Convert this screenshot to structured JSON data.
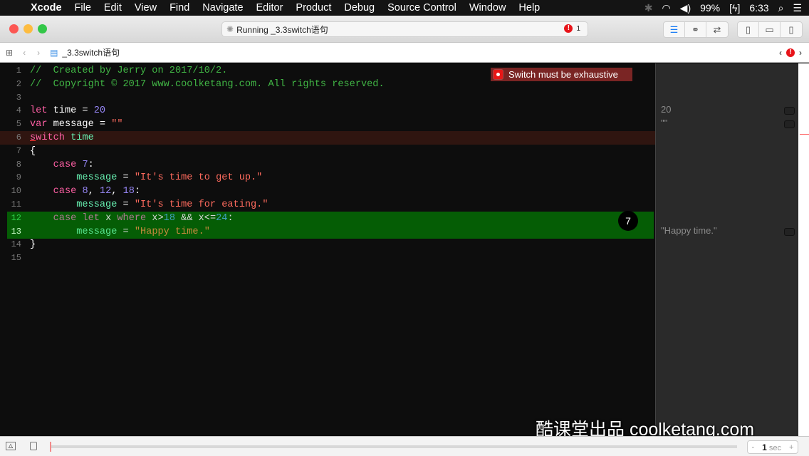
{
  "menubar": {
    "app": "Xcode",
    "items": [
      "File",
      "Edit",
      "View",
      "Find",
      "Navigate",
      "Editor",
      "Product",
      "Debug",
      "Source Control",
      "Window",
      "Help"
    ],
    "battery": "99%",
    "time": "6:33"
  },
  "toolbar": {
    "activity": "Running _3.3switch语句",
    "error_count": "1"
  },
  "jumpbar": {
    "file": "_3.3switch语句"
  },
  "editor": {
    "lines": [
      [
        [
          "//  Created by Jerry on 2017/10/2.",
          "comment"
        ]
      ],
      [
        [
          "//  Copyright © 2017 www.coolketang.com. All rights reserved.",
          "comment"
        ]
      ],
      [],
      [
        [
          "let",
          "kw"
        ],
        [
          " time = ",
          "plain"
        ],
        [
          "20",
          "num"
        ]
      ],
      [
        [
          "var",
          "kw"
        ],
        [
          " message = ",
          "plain"
        ],
        [
          "\"\"",
          "str"
        ]
      ],
      [
        [
          "s",
          "kw sq"
        ],
        [
          "witch",
          "kw"
        ],
        [
          " ",
          "plain"
        ],
        [
          "time",
          "id"
        ]
      ],
      [
        [
          "{",
          "plain"
        ]
      ],
      [
        [
          "    case",
          "kw"
        ],
        [
          " ",
          "plain"
        ],
        [
          "7",
          "num"
        ],
        [
          ":",
          "plain"
        ]
      ],
      [
        [
          "        message",
          "id"
        ],
        [
          " = ",
          "plain"
        ],
        [
          "\"It's time to get up.\"",
          "str"
        ]
      ],
      [
        [
          "    case",
          "kw"
        ],
        [
          " ",
          "plain"
        ],
        [
          "8",
          "num"
        ],
        [
          ", ",
          "plain"
        ],
        [
          "12",
          "num"
        ],
        [
          ", ",
          "plain"
        ],
        [
          "18",
          "num"
        ],
        [
          ":",
          "plain"
        ]
      ],
      [
        [
          "        message",
          "id"
        ],
        [
          " = ",
          "plain"
        ],
        [
          "\"It's time for eating.\"",
          "str"
        ]
      ],
      [
        [
          "    case let",
          "kw"
        ],
        [
          " x ",
          "plain"
        ],
        [
          "where",
          "kw"
        ],
        [
          " x>",
          "plain"
        ],
        [
          "18",
          "num"
        ],
        [
          " && x<=",
          "plain"
        ],
        [
          "24",
          "num"
        ],
        [
          ":",
          "plain"
        ]
      ],
      [
        [
          "        message",
          "id"
        ],
        [
          " = ",
          "plain"
        ],
        [
          "\"Happy time.\"",
          "str"
        ]
      ],
      [
        [
          "}",
          "plain"
        ]
      ],
      []
    ],
    "error_message": "Switch must be exhaustive",
    "counter": "7"
  },
  "results": {
    "time": "20",
    "message": "\"\"",
    "happy": "\"Happy time.\""
  },
  "watermark": "酷课堂出品 coolketang.com",
  "debugbar": {
    "value": "1",
    "unit": "sec",
    "minus": "-",
    "plus": "+"
  },
  "colors": {
    "error": "#e8141a",
    "highlight": "#055d05",
    "accent": "#1a7cf5"
  }
}
